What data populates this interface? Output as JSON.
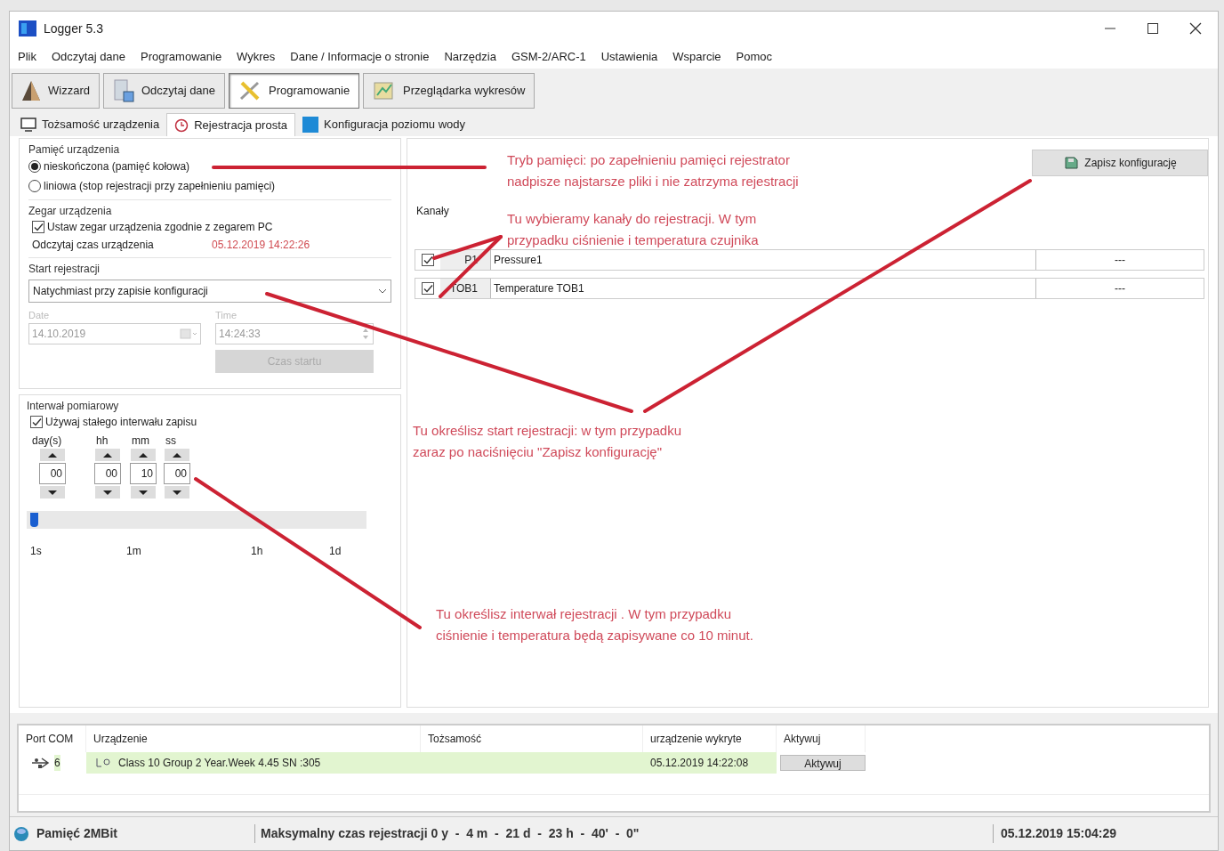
{
  "window": {
    "title": "Logger 5.3"
  },
  "menu": [
    "Plik",
    "Odczytaj dane",
    "Programowanie",
    "Wykres",
    "Dane / Informacje o stronie",
    "Narzędzia",
    "GSM-2/ARC-1",
    "Ustawienia",
    "Wsparcie",
    "Pomoc"
  ],
  "toolbar": [
    {
      "label": "Wizzard",
      "selected": false
    },
    {
      "label": "Odczytaj dane",
      "selected": false
    },
    {
      "label": "Programowanie",
      "selected": true
    },
    {
      "label": "Przeglądarka wykresów",
      "selected": false
    }
  ],
  "tabs": [
    {
      "label": "Tożsamość urządzenia",
      "selected": false
    },
    {
      "label": "Rejestracja prosta",
      "selected": true
    },
    {
      "label": "Konfiguracja poziomu wody",
      "selected": false
    }
  ],
  "memory": {
    "title": "Pamięć urządzenia",
    "options": [
      {
        "label": "nieskończona (pamięć kołowa)",
        "selected": true
      },
      {
        "label": "liniowa (stop rejestracji przy zapełnieniu pamięci)",
        "selected": false
      }
    ]
  },
  "clock": {
    "title": "Zegar urządzenia",
    "sync": {
      "label": "Ustaw zegar urządzenia zgodnie z zegarem PC",
      "checked": true
    },
    "read_label": "Odczytaj czas urządzenia",
    "read_value": "05.12.2019 14:22:26"
  },
  "start": {
    "title": "Start rejestracji",
    "mode": "Natychmiast przy zapisie konfiguracji",
    "date_label": "Date",
    "date_value": "14.10.2019",
    "time_label": "Time",
    "time_value": "14:24:33",
    "button": {
      "label": "Czas startu",
      "disabled": true
    }
  },
  "interval": {
    "title": "Interwał pomiarowy",
    "fixed": {
      "label": "Używaj stałego interwału zapisu",
      "checked": true
    },
    "units": [
      "day(s)",
      "hh",
      "mm",
      "ss"
    ],
    "values": [
      "00",
      "00",
      "10",
      "00"
    ],
    "slider": {
      "level": 0.01
    },
    "scale": [
      "1s",
      "1m",
      "1h",
      "1d"
    ]
  },
  "channels": {
    "title": "Kanały",
    "save_button": "Zapisz konfigurację",
    "rows": [
      {
        "checked": true,
        "code": "P1",
        "name": "Pressure1",
        "value": "---"
      },
      {
        "checked": true,
        "code": "TOB1",
        "name": "Temperature TOB1",
        "value": "---"
      }
    ]
  },
  "devices": {
    "columns": [
      "Port COM",
      "Urządzenie",
      "Tożsamość",
      "urządzenie wykryte",
      "Aktywuj"
    ],
    "rows": [
      {
        "port": "6",
        "device": "Class 10 Group 2 Year.Week 4.45 SN :305",
        "identity": "",
        "detected": "05.12.2019 14:22:08",
        "button": "Aktywuj"
      }
    ]
  },
  "status_bar": [
    "Pamięć 2MBit",
    "Maksymalny czas rejestracji 0 y  -  4 m  -  21 d  -  23 h  -  40'  -  0\"",
    "05.12.2019 15:04:29"
  ],
  "annotations": [
    [
      "Tryb pamięci: po zapełnieniu pamięci rejestrator",
      "nadpisze najstarsze pliki i nie zatrzyma rejestracji"
    ],
    [
      "Tu wybieramy kanały do rejestracji. W tym",
      "przypadku ciśnienie i temperatura czujnika"
    ],
    [
      "Tu określisz start rejestracji: w tym przypadku",
      "zaraz po naciśnięciu \"Zapisz konfigurację\""
    ],
    [
      "Tu określisz interwał rejestracji . W tym przypadku",
      "ciśnienie i temperatura będą zapisywane co 10 minut."
    ]
  ]
}
